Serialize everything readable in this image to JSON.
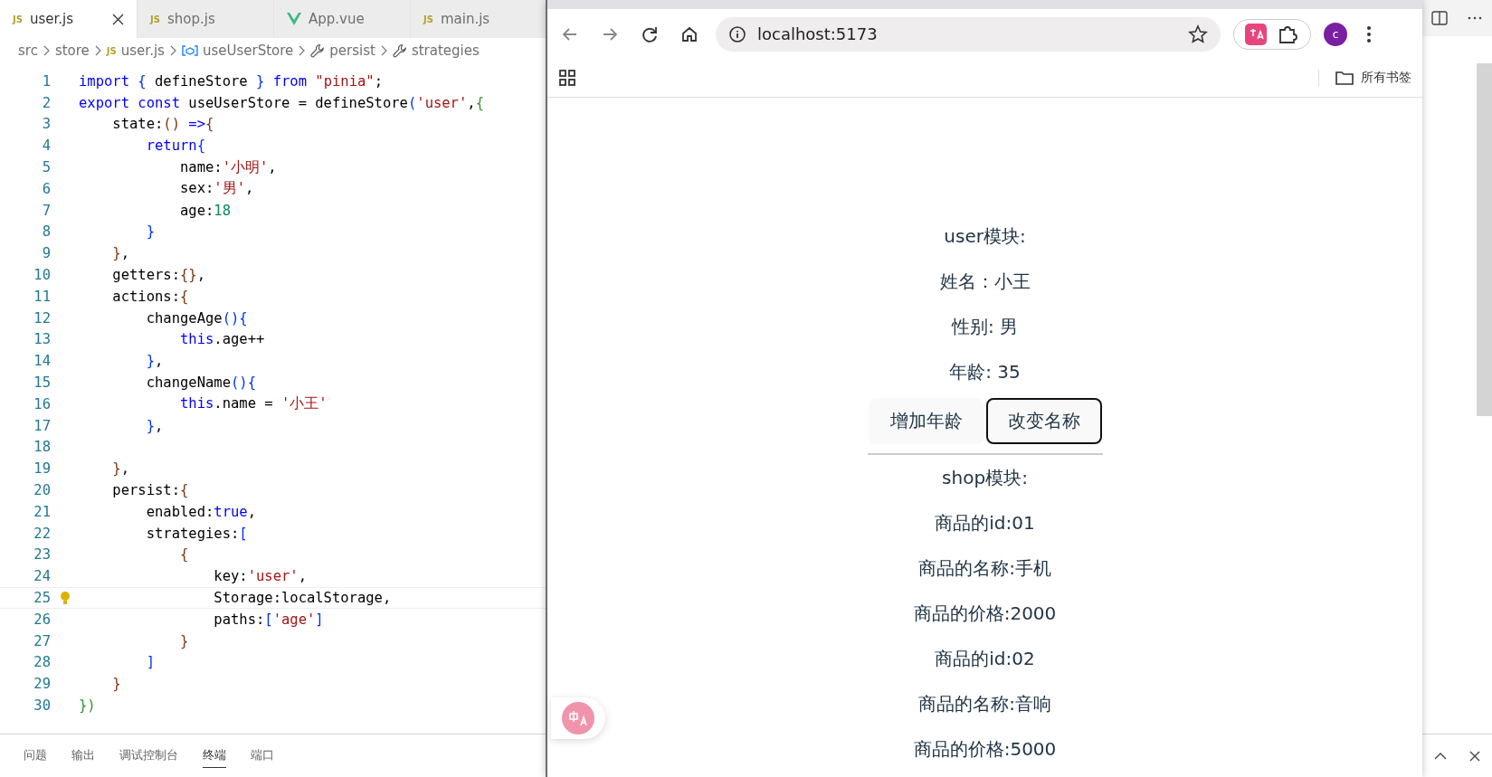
{
  "editor": {
    "tabs": [
      {
        "label": "user.js",
        "kind": "js",
        "icon_label": "JS",
        "selected": true
      },
      {
        "label": "shop.js",
        "kind": "js",
        "icon_label": "JS",
        "selected": false
      },
      {
        "label": "App.vue",
        "kind": "vue",
        "selected": false
      },
      {
        "label": "main.js",
        "kind": "js",
        "icon_label": "JS",
        "selected": false
      }
    ],
    "breadcrumb": [
      {
        "label": "src",
        "kind": "folder"
      },
      {
        "label": "store",
        "kind": "folder"
      },
      {
        "label": "user.js",
        "kind": "js",
        "icon_label": "JS"
      },
      {
        "label": "useUserStore",
        "kind": "variable"
      },
      {
        "label": "persist",
        "kind": "wrench"
      },
      {
        "label": "strategies",
        "kind": "wrench"
      }
    ],
    "code_lines": [
      {
        "number": "1",
        "current": false,
        "tokens": [
          {
            "text": "import",
            "kind": "keyword"
          },
          {
            "text": " { ",
            "kind": "bracket"
          },
          {
            "text": "defineStore",
            "kind": "plain"
          },
          {
            "text": " } ",
            "kind": "bracket"
          },
          {
            "text": "from",
            "kind": "keyword"
          },
          {
            "text": " \"pinia\"",
            "kind": "string"
          },
          {
            "text": ";",
            "kind": "plain"
          }
        ]
      },
      {
        "number": "2",
        "current": false,
        "tokens": [
          {
            "text": "export const",
            "kind": "keyword"
          },
          {
            "text": " useUserStore = defineStore",
            "kind": "plain"
          },
          {
            "text": "(",
            "kind": "bracket"
          },
          {
            "text": "'user'",
            "kind": "string"
          },
          {
            "text": ",",
            "kind": "plain"
          },
          {
            "text": "{",
            "kind": "bracket2"
          }
        ]
      },
      {
        "number": "3",
        "current": false,
        "tokens": [
          {
            "text": "    state:",
            "kind": "plain"
          },
          {
            "text": "()",
            "kind": "bracket3"
          },
          {
            "text": " =>",
            "kind": "keyword"
          },
          {
            "text": "{",
            "kind": "bracket3"
          }
        ]
      },
      {
        "number": "4",
        "current": false,
        "tokens": [
          {
            "text": "        return",
            "kind": "keyword"
          },
          {
            "text": "{",
            "kind": "bracket"
          }
        ]
      },
      {
        "number": "5",
        "current": false,
        "tokens": [
          {
            "text": "            name:",
            "kind": "plain"
          },
          {
            "text": "'小明'",
            "kind": "string"
          },
          {
            "text": ",",
            "kind": "plain"
          }
        ]
      },
      {
        "number": "6",
        "current": false,
        "tokens": [
          {
            "text": "            sex:",
            "kind": "plain"
          },
          {
            "text": "'男'",
            "kind": "string"
          },
          {
            "text": ",",
            "kind": "plain"
          }
        ]
      },
      {
        "number": "7",
        "current": false,
        "tokens": [
          {
            "text": "            age:",
            "kind": "plain"
          },
          {
            "text": "18",
            "kind": "number"
          }
        ]
      },
      {
        "number": "8",
        "current": false,
        "tokens": [
          {
            "text": "        }",
            "kind": "bracket"
          }
        ]
      },
      {
        "number": "9",
        "current": false,
        "tokens": [
          {
            "text": "    }",
            "kind": "bracket3"
          },
          {
            "text": ",",
            "kind": "plain"
          }
        ]
      },
      {
        "number": "10",
        "current": false,
        "tokens": [
          {
            "text": "    getters:",
            "kind": "plain"
          },
          {
            "text": "{}",
            "kind": "bracket3"
          },
          {
            "text": ",",
            "kind": "plain"
          }
        ]
      },
      {
        "number": "11",
        "current": false,
        "tokens": [
          {
            "text": "    actions:",
            "kind": "plain"
          },
          {
            "text": "{",
            "kind": "bracket3"
          }
        ]
      },
      {
        "number": "12",
        "current": false,
        "tokens": [
          {
            "text": "        changeAge",
            "kind": "plain"
          },
          {
            "text": "(){",
            "kind": "bracket"
          }
        ]
      },
      {
        "number": "13",
        "current": false,
        "tokens": [
          {
            "text": "            this",
            "kind": "keyword"
          },
          {
            "text": ".age++",
            "kind": "plain"
          }
        ]
      },
      {
        "number": "14",
        "current": false,
        "tokens": [
          {
            "text": "        }",
            "kind": "bracket"
          },
          {
            "text": ",",
            "kind": "plain"
          }
        ]
      },
      {
        "number": "15",
        "current": false,
        "tokens": [
          {
            "text": "        changeName",
            "kind": "plain"
          },
          {
            "text": "(){",
            "kind": "bracket"
          }
        ]
      },
      {
        "number": "16",
        "current": false,
        "tokens": [
          {
            "text": "            this",
            "kind": "keyword"
          },
          {
            "text": ".name = ",
            "kind": "plain"
          },
          {
            "text": "'小王'",
            "kind": "string"
          }
        ]
      },
      {
        "number": "17",
        "current": false,
        "tokens": [
          {
            "text": "        }",
            "kind": "bracket"
          },
          {
            "text": ",",
            "kind": "plain"
          }
        ]
      },
      {
        "number": "18",
        "current": false
      },
      {
        "number": "19",
        "current": false,
        "tokens": [
          {
            "text": "    }",
            "kind": "bracket3"
          },
          {
            "text": ",",
            "kind": "plain"
          }
        ]
      },
      {
        "number": "20",
        "current": false,
        "tokens": [
          {
            "text": "    persist:",
            "kind": "plain"
          },
          {
            "text": "{",
            "kind": "bracket3"
          }
        ]
      },
      {
        "number": "21",
        "current": false,
        "tokens": [
          {
            "text": "        enabled:",
            "kind": "plain"
          },
          {
            "text": "true",
            "kind": "keyword"
          },
          {
            "text": ",",
            "kind": "plain"
          }
        ]
      },
      {
        "number": "22",
        "current": false,
        "tokens": [
          {
            "text": "        strategies:",
            "kind": "plain"
          },
          {
            "text": "[",
            "kind": "bracket"
          }
        ]
      },
      {
        "number": "23",
        "current": false,
        "tokens": [
          {
            "text": "            {",
            "kind": "bracket3"
          }
        ]
      },
      {
        "number": "24",
        "current": false,
        "tokens": [
          {
            "text": "                key:",
            "kind": "plain"
          },
          {
            "text": "'user'",
            "kind": "string"
          },
          {
            "text": ",",
            "kind": "plain"
          }
        ]
      },
      {
        "number": "25",
        "current": true,
        "tokens": [
          {
            "text": "                Storage:localStorage,",
            "kind": "plain"
          }
        ]
      },
      {
        "number": "26",
        "current": false,
        "tokens": [
          {
            "text": "                paths:",
            "kind": "plain"
          },
          {
            "text": "[",
            "kind": "bracket"
          },
          {
            "text": "'age'",
            "kind": "string"
          },
          {
            "text": "]",
            "kind": "bracket"
          }
        ]
      },
      {
        "number": "27",
        "current": false,
        "tokens": [
          {
            "text": "            }",
            "kind": "bracket3"
          }
        ]
      },
      {
        "number": "28",
        "current": false,
        "tokens": [
          {
            "text": "        ]",
            "kind": "bracket"
          }
        ]
      },
      {
        "number": "29",
        "current": false,
        "tokens": [
          {
            "text": "    }",
            "kind": "bracket3"
          }
        ]
      },
      {
        "number": "30",
        "current": false,
        "tokens": [
          {
            "text": "})",
            "kind": "bracket2"
          }
        ]
      }
    ],
    "panel_tabs": [
      {
        "label": "问题",
        "selected": false
      },
      {
        "label": "输出",
        "selected": false
      },
      {
        "label": "调试控制台",
        "selected": false
      },
      {
        "label": "终端",
        "selected": true
      },
      {
        "label": "端口",
        "selected": false
      }
    ]
  },
  "browser": {
    "address": "localhost:5173",
    "bookmarks_label": "所有书签",
    "avatar_letter": "c",
    "content": [
      {
        "kind": "text",
        "text": "user模块:"
      },
      {
        "kind": "text",
        "text": "姓名：小王"
      },
      {
        "kind": "text",
        "text": "性别: 男"
      },
      {
        "kind": "text",
        "text": "年龄: 35"
      },
      {
        "kind": "buttons",
        "buttons": [
          {
            "label": "增加年龄",
            "focused": false
          },
          {
            "label": "改变名称",
            "focused": true
          }
        ]
      },
      {
        "kind": "rule"
      },
      {
        "kind": "text",
        "text": "shop模块:"
      },
      {
        "kind": "text",
        "text": "商品的id:01"
      },
      {
        "kind": "text",
        "text": "商品的名称:手机"
      },
      {
        "kind": "text",
        "text": "商品的价格:2000"
      },
      {
        "kind": "text",
        "text": "商品的id:02"
      },
      {
        "kind": "text",
        "text": "商品的名称:音响"
      },
      {
        "kind": "text",
        "text": "商品的价格:5000"
      }
    ]
  }
}
